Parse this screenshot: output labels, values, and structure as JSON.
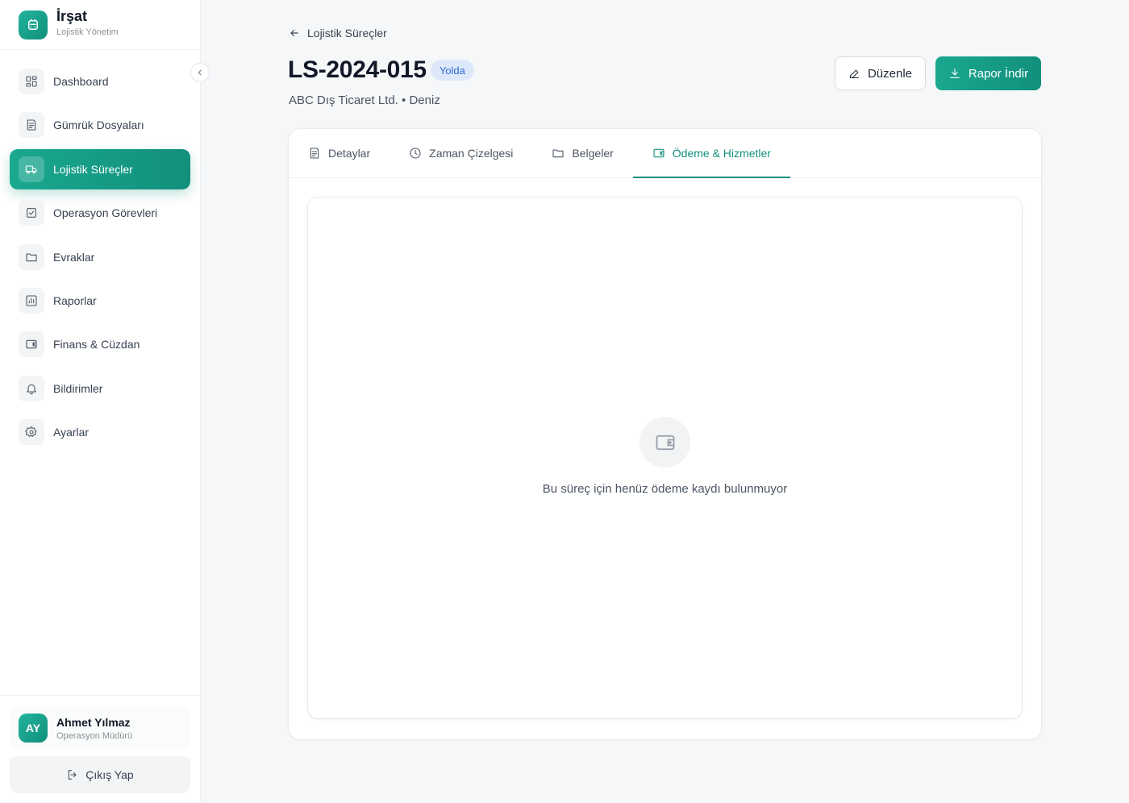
{
  "brand": {
    "title": "İrşat",
    "subtitle": "Lojistik Yönetim"
  },
  "sidebar": {
    "items": [
      {
        "label": "Dashboard",
        "icon": "dashboard-icon"
      },
      {
        "label": "Gümrük Dosyaları",
        "icon": "document-icon"
      },
      {
        "label": "Lojistik Süreçler",
        "icon": "truck-icon",
        "active": true
      },
      {
        "label": "Operasyon Görevleri",
        "icon": "checkbox-icon"
      },
      {
        "label": "Evraklar",
        "icon": "folder-icon"
      },
      {
        "label": "Raporlar",
        "icon": "chart-icon"
      },
      {
        "label": "Finans & Cüzdan",
        "icon": "wallet-icon"
      },
      {
        "label": "Bildirimler",
        "icon": "bell-icon"
      },
      {
        "label": "Ayarlar",
        "icon": "gear-icon"
      }
    ]
  },
  "user": {
    "initials": "AY",
    "name": "Ahmet Yılmaz",
    "role": "Operasyon Müdürü"
  },
  "logout_label": "Çıkış Yap",
  "header": {
    "back_label": "Lojistik Süreçler",
    "title": "LS-2024-015",
    "status": "Yolda",
    "subtitle": "ABC Dış Ticaret Ltd. • Deniz",
    "edit_label": "Düzenle",
    "report_label": "Rapor İndir"
  },
  "tabs": [
    {
      "label": "Detaylar",
      "icon": "document-icon"
    },
    {
      "label": "Zaman Çizelgesi",
      "icon": "clock-icon"
    },
    {
      "label": "Belgeler",
      "icon": "folder-icon"
    },
    {
      "label": "Ödeme & Hizmetler",
      "icon": "wallet-icon",
      "active": true
    }
  ],
  "empty_state": {
    "message": "Bu süreç için henüz ödeme kaydı bulunmuyor",
    "icon": "wallet-icon"
  },
  "colors": {
    "accent": "#11907c",
    "status_bg": "#dde9fb",
    "status_text": "#2f6bd6"
  }
}
